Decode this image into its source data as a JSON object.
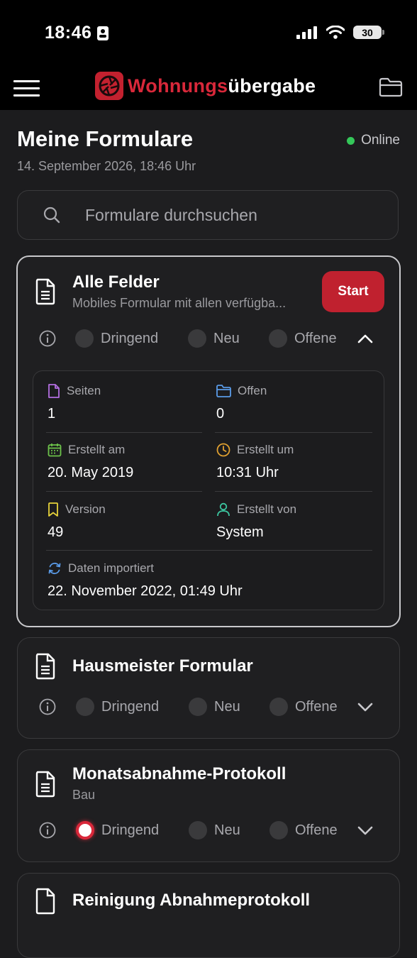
{
  "status_bar": {
    "time": "18:46",
    "battery": "30"
  },
  "app": {
    "brand_red": "Wohnungs",
    "brand_white": "übergabe"
  },
  "header": {
    "title": "Meine Formulare",
    "date": "14. September 2026, 18:46 Uhr",
    "status": "Online"
  },
  "search": {
    "placeholder": "Formulare durchsuchen"
  },
  "flag_labels": {
    "urgent": "Dringend",
    "new": "Neu",
    "open": "Offene"
  },
  "forms": [
    {
      "title": "Alle Felder",
      "subtitle": "Mobiles Formular mit allen verfügba...",
      "start_label": "Start",
      "expanded": true,
      "urgent": false,
      "details": {
        "pages_label": "Seiten",
        "pages": "1",
        "open_label": "Offen",
        "open": "0",
        "created_on_label": "Erstellt am",
        "created_on": "20. May 2019",
        "created_at_label": "Erstellt um",
        "created_at": "10:31 Uhr",
        "version_label": "Version",
        "version": "49",
        "created_by_label": "Erstellt von",
        "created_by": "System",
        "imported_label": "Daten importiert",
        "imported": "22. November 2022, 01:49 Uhr"
      }
    },
    {
      "title": "Hausmeister Formular",
      "expanded": false,
      "urgent": false
    },
    {
      "title": "Monatsabnahme-Protokoll",
      "subtitle": "Bau",
      "expanded": false,
      "urgent": true
    },
    {
      "title": "Reinigung Abnahmeprotokoll",
      "expanded": false,
      "urgent": false
    }
  ],
  "colors": {
    "accent": "#c0212f",
    "online": "#34c759",
    "background": "#1c1c1e",
    "card": "#1f1f21"
  },
  "icons": {
    "menu": "hamburger-icon",
    "folder": "folder-icon",
    "search": "search-icon",
    "document": "document-icon",
    "info": "info-icon",
    "chevron_up": "chevron-up-icon",
    "chevron_down": "chevron-down-icon",
    "pages": "file-icon",
    "open": "folder-icon",
    "created_on": "calendar-icon",
    "created_at": "clock-icon",
    "version": "bookmark-icon",
    "created_by": "user-icon",
    "imported": "refresh-icon"
  }
}
